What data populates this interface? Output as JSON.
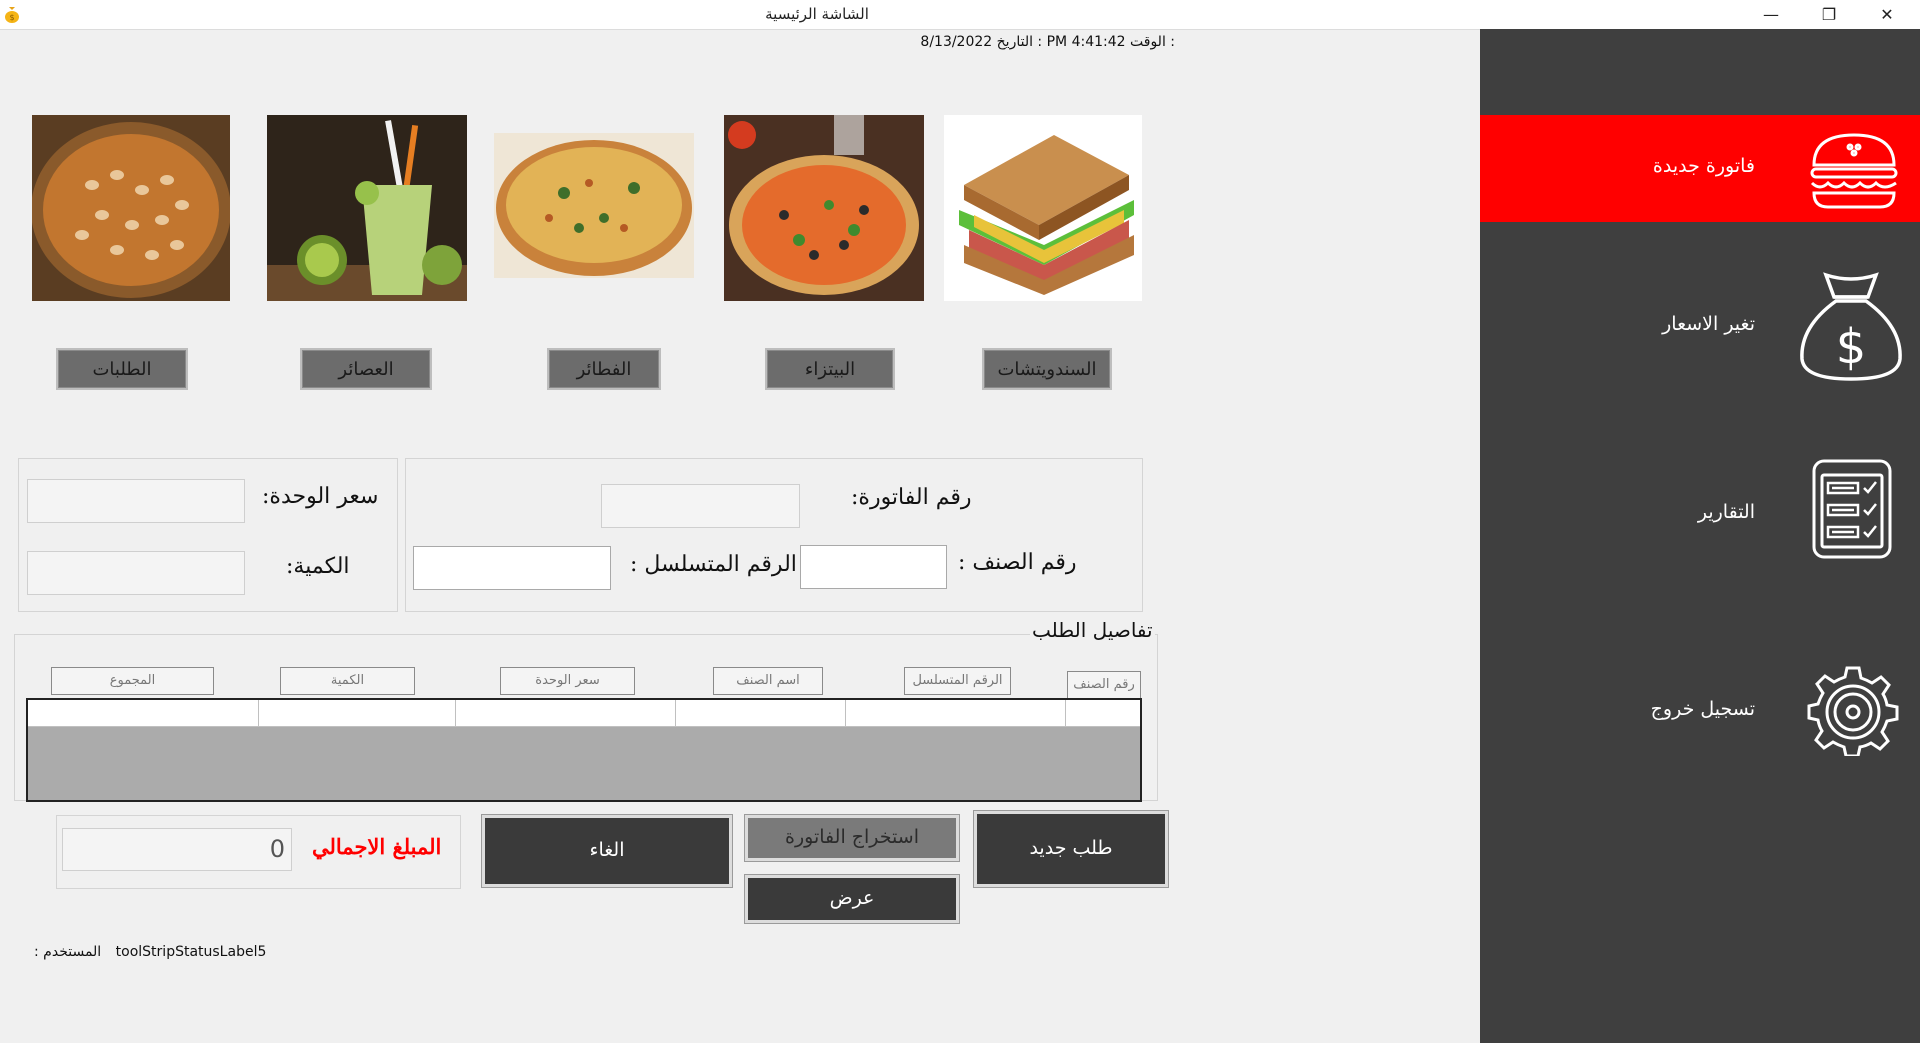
{
  "window": {
    "title": "الشاشة الرئيسية",
    "minimize": "—",
    "restore": "❐",
    "close": "✕"
  },
  "header": {
    "datetime": "8/13/2022  التاريخ :  PM 4:41:42  الوقت :"
  },
  "sidebar": {
    "items": [
      {
        "label": "فاتورة جديدة",
        "icon": "burger-icon"
      },
      {
        "label": "تغير الاسعار",
        "icon": "money-bag-icon"
      },
      {
        "label": "التقارير",
        "icon": "report-checklist-icon"
      },
      {
        "label": "تسجيل خروج",
        "icon": "gear-icon"
      }
    ],
    "active_color": "#ff0000",
    "background": "#3f3f3f"
  },
  "categories": [
    {
      "label": "السندويتشات",
      "image": "sandwich"
    },
    {
      "label": "البيتزاء",
      "image": "pizza"
    },
    {
      "label": "الفطائر",
      "image": "pie"
    },
    {
      "label": "العصائر",
      "image": "juice"
    },
    {
      "label": "الطلبات",
      "image": "beans"
    }
  ],
  "form": {
    "invoice_no_label": "رقم الفاتورة:",
    "item_no_label": "رقم الصنف :",
    "serial_no_label": "الرقم المتسلسل :",
    "unit_price_label": "سعر الوحدة:",
    "quantity_label": "الكمية:"
  },
  "order": {
    "title": "تفاصيل الطلب",
    "columns": [
      "رقم الصنف",
      "الرقم المتسلسل",
      "اسم الصنف",
      "سعر الوحدة",
      "الكمية",
      "المجموع"
    ]
  },
  "totals": {
    "label": "المبلغ الاجمالي",
    "value": "0",
    "label_color": "#ff0000"
  },
  "actions": {
    "new_order": "طلب جديد",
    "extract_invoice": "استخراج الفاتورة",
    "cancel": "الغاء",
    "view": "عرض"
  },
  "status": {
    "user_label": ": المستخدم",
    "user_value": "toolStripStatusLabel5"
  }
}
